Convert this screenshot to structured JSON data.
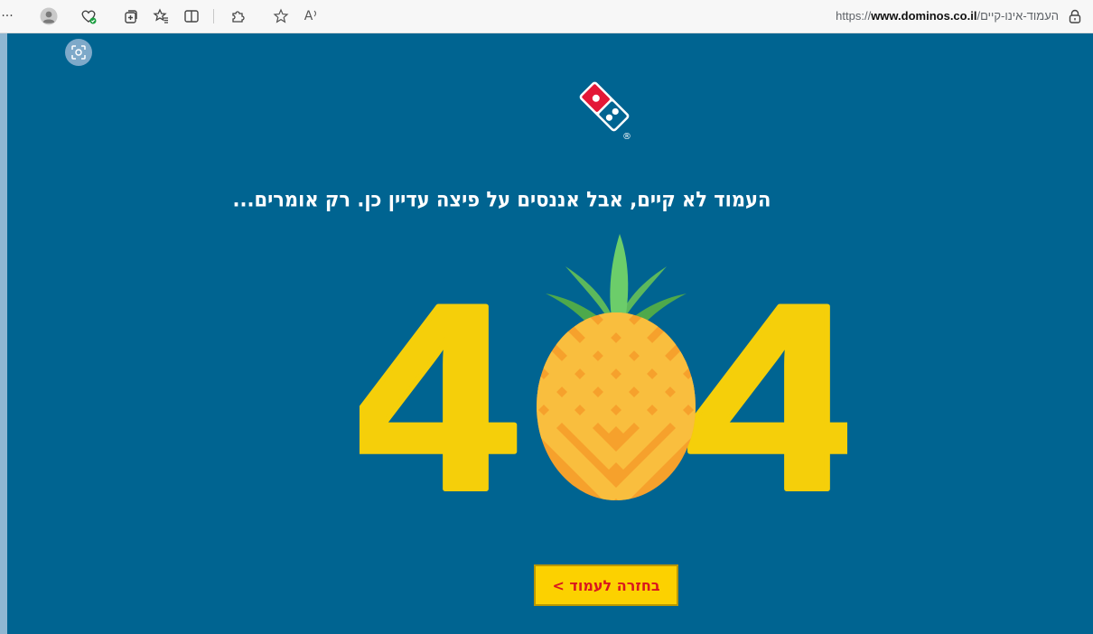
{
  "browser": {
    "more_label": "···",
    "url_scheme": "https://",
    "url_host": "www.dominos.co.il",
    "url_path": "/העמוד-אינו-קיים",
    "toolbar_icons": [
      "profile-icon",
      "browser-essentials-icon",
      "collections-icon",
      "favorites-icon",
      "split-screen-icon",
      "extensions-icon",
      "star-icon",
      "read-aloud-icon",
      "lock-icon"
    ],
    "read_aloud_label": "A"
  },
  "page": {
    "message": "העמוד לא קיים, אבל אננסים על פיצה עדיין כן. רק אומרים...",
    "error_left_digit": "4",
    "error_right_digit": "4",
    "back_button_label": "בחזרה לעמוד >",
    "logo_mark": "®"
  },
  "colors": {
    "page_background": "#006491",
    "digit_yellow": "#f5cf0a",
    "pineapple_orange": "#f6a12c",
    "leaf_green": "#5cb85c",
    "button_yellow": "#fcd100",
    "button_text_red": "#d9171e",
    "logo_red": "#e31837"
  }
}
